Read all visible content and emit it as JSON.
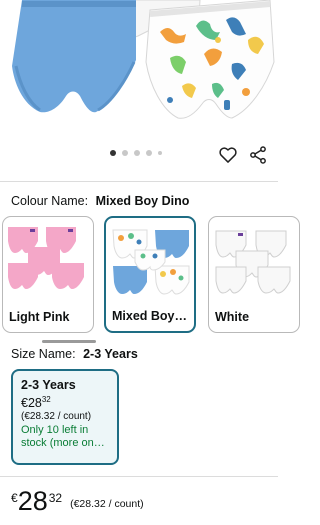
{
  "gallery": {
    "dots_total": 5,
    "active_index": 0
  },
  "colour": {
    "label": "Colour Name:",
    "value": "Mixed Boy Dino",
    "options": [
      {
        "name": "Light Pink",
        "color": "#f4a7c8"
      },
      {
        "name": "Mixed Boy…",
        "color": "#6ea6dc"
      },
      {
        "name": "White",
        "color": "#f3f3f3"
      }
    ],
    "selected_index": 1
  },
  "size": {
    "label": "Size Name:",
    "value": "2-3 Years",
    "option": {
      "title": "2-3 Years",
      "currency": "€",
      "price_whole": "28",
      "price_fraction": "32",
      "unit_price": "(€28.32 / count)",
      "stock_line1": "Only 10 left in",
      "stock_line2": "stock (more on…"
    }
  },
  "price": {
    "currency": "€",
    "whole": "28",
    "fraction": "32",
    "unit_price": "(€28.32 / count)"
  },
  "colors": {
    "accent": "#1e6d84",
    "accent_bg": "#edf6f8",
    "stock_green": "#0a7d36",
    "blue_pant": "#6ea6dc"
  }
}
